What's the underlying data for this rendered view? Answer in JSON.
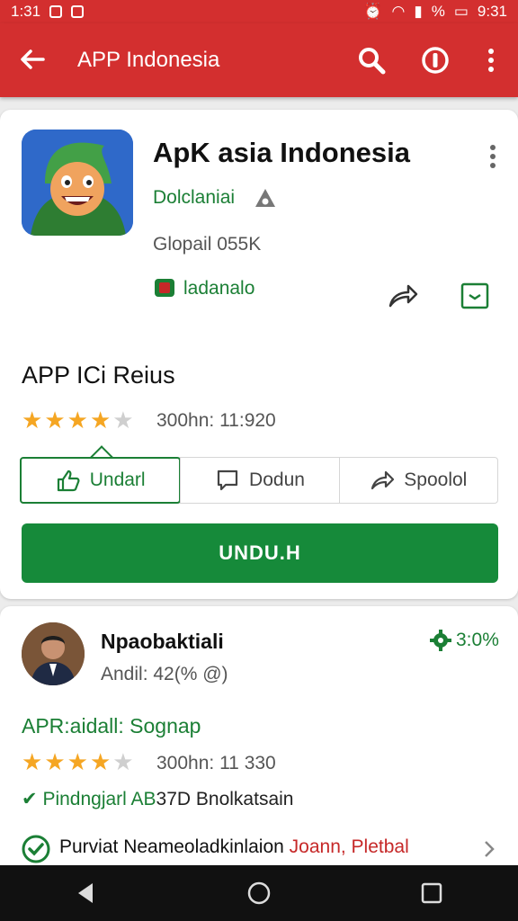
{
  "status_bar": {
    "time_left": "1:31",
    "time_right": "9:31",
    "battery": "%"
  },
  "app_bar": {
    "title": "APP Indonesia"
  },
  "app": {
    "name": "ApK asia Indonesia",
    "developer": "Dolclaniai",
    "size": "Glopail 055K",
    "verified_label": "ladanalo"
  },
  "ratings_section": {
    "title": "APP ICi Reius",
    "stars": 4,
    "rating_text": "300hn: 11:920"
  },
  "tabs": [
    {
      "label": "Undarl",
      "icon": "thumb-up-icon"
    },
    {
      "label": "Dodun",
      "icon": "comment-icon"
    },
    {
      "label": "Spoolol",
      "icon": "share-icon"
    }
  ],
  "download_button": {
    "label": "UNDU.H"
  },
  "review": {
    "reviewer": "Npaobaktiali",
    "percent": "3:0%",
    "meta": "Andil: 42(% @)",
    "label": "APR:aidall: Sognap",
    "stars": 4,
    "rating_text": "300hn: 11 330",
    "check_green": "Pindngjarl AB",
    "check_dark": "37D Bnolkatsain",
    "bottom_text": "Purviat Neameoladkinlaion",
    "bottom_red": "Joann, Pletbal"
  },
  "colors": {
    "red": "#d32f2f",
    "green": "#168a3a",
    "star": "#f5a623"
  }
}
